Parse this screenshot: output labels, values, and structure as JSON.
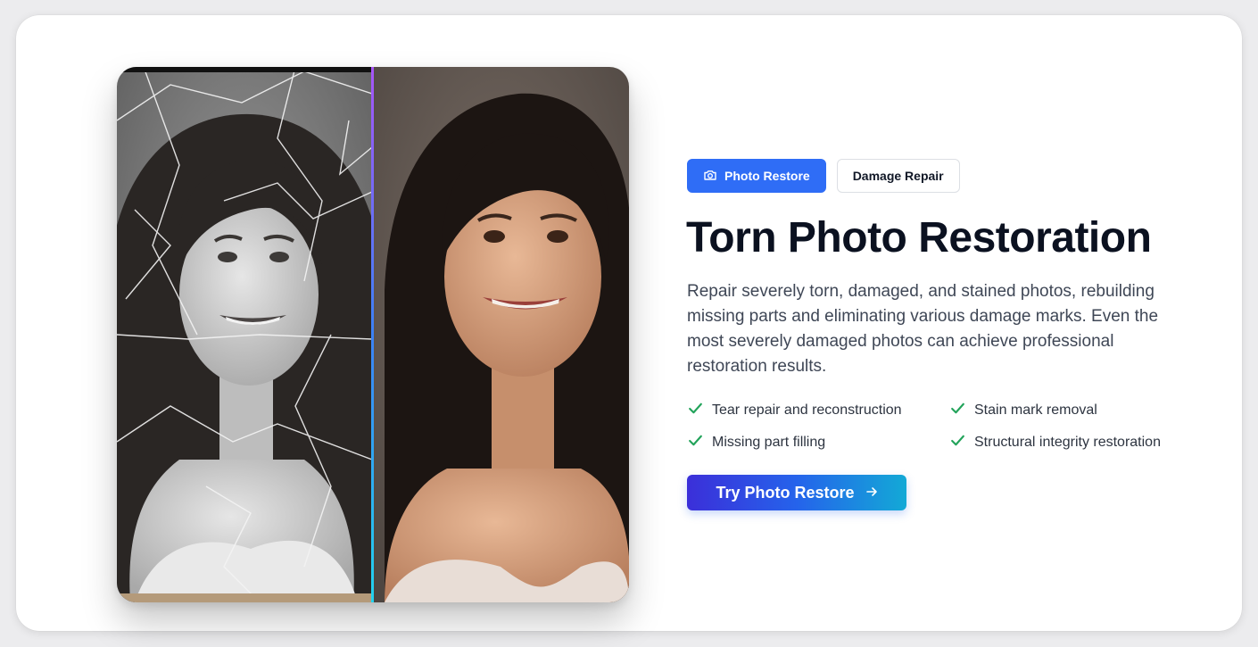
{
  "tabs": [
    {
      "label": "Photo Restore",
      "icon": "camera-icon",
      "active": true
    },
    {
      "label": "Damage Repair",
      "active": false
    }
  ],
  "title": "Torn Photo Restoration",
  "description": "Repair severely torn, damaged, and stained photos, rebuilding missing parts and eliminating various damage marks. Even the most severely damaged photos can achieve professional restoration results.",
  "features": [
    "Tear repair and reconstruction",
    "Stain mark removal",
    "Missing part filling",
    "Structural integrity restoration"
  ],
  "cta": {
    "label": "Try Photo Restore",
    "icon": "arrow-right-icon"
  },
  "colors": {
    "accent": "#2f6df6",
    "check": "#22a35a",
    "cta_gradient": [
      "#3b2fd9",
      "#13a9d6"
    ],
    "divider_gradient": [
      "#a855f7",
      "#22d3ee"
    ]
  }
}
